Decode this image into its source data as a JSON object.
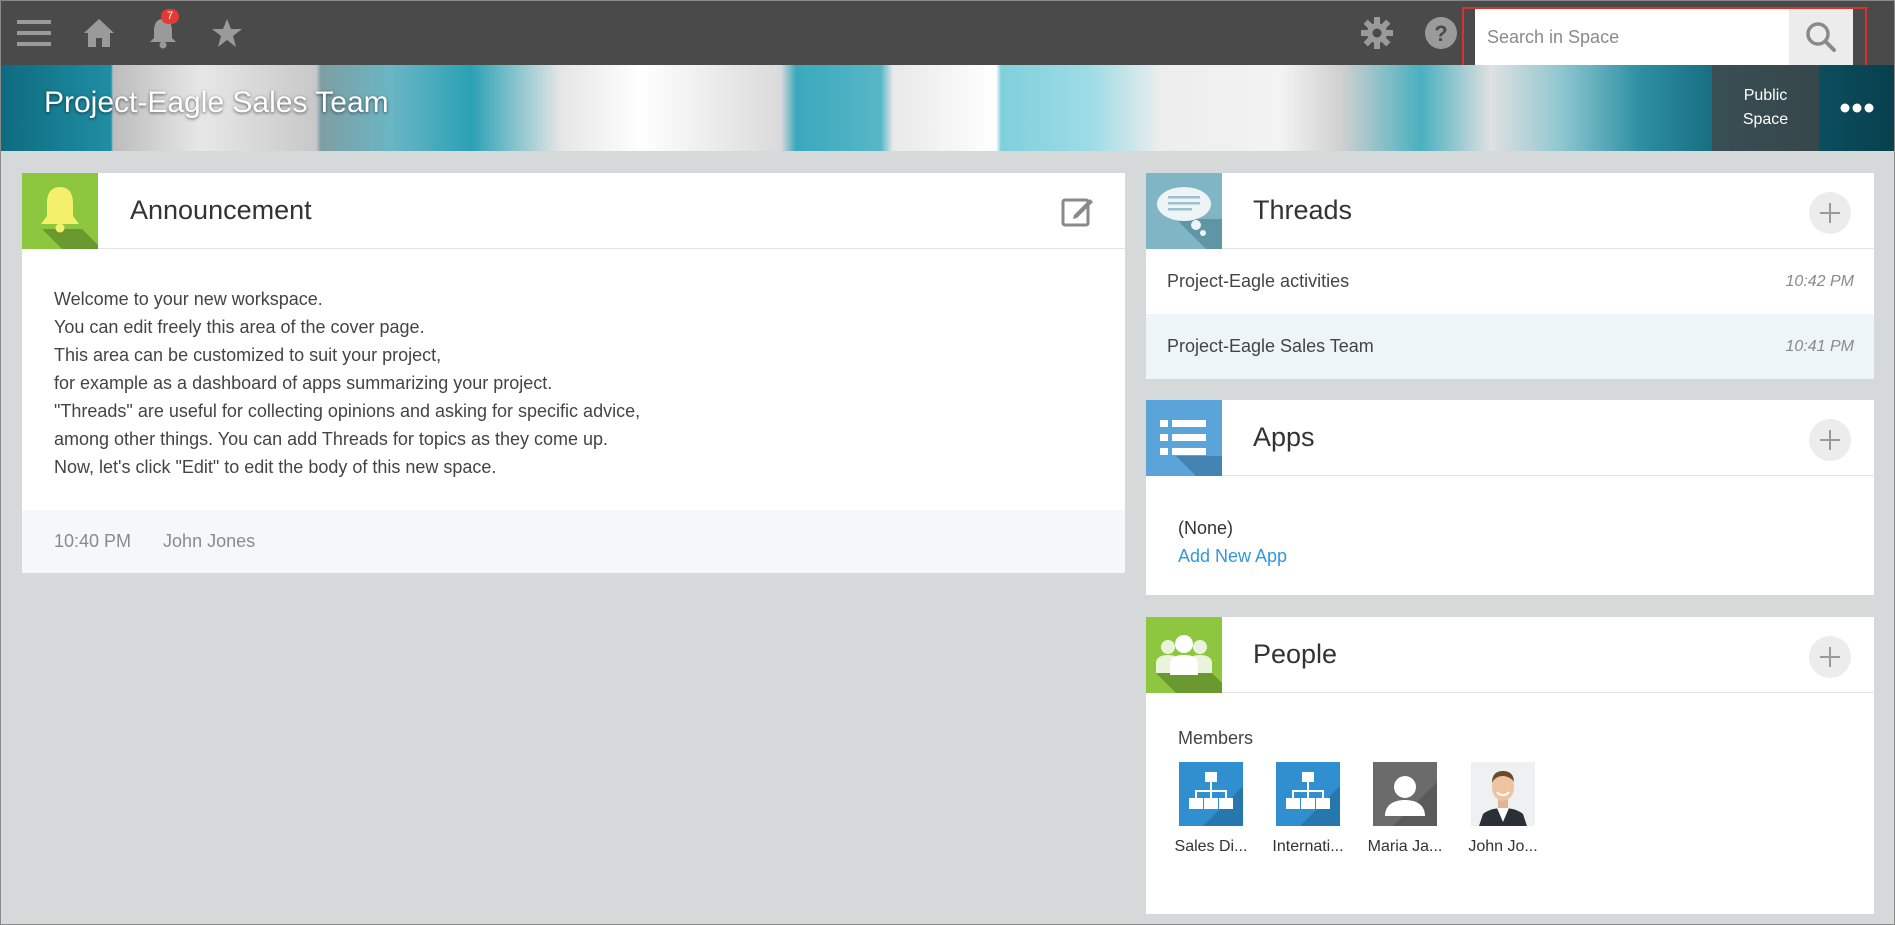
{
  "topbar": {
    "notification_count": "7",
    "search": {
      "placeholder": "Search in Space"
    }
  },
  "banner": {
    "title": "Project-Eagle Sales Team",
    "visibility_line1": "Public",
    "visibility_line2": "Space"
  },
  "announcement": {
    "title": "Announcement",
    "lines": [
      "Welcome to your new workspace.",
      "You can edit freely this area of the cover page.",
      "This area can be customized to suit your project,",
      "for example as a dashboard of apps summarizing your project.",
      "\"Threads\" are useful for collecting opinions and asking for specific advice,",
      "among other things. You can add Threads for topics as they come up.",
      "Now, let's click \"Edit\" to edit the body of this new space."
    ],
    "time": "10:40 PM",
    "author": "John Jones"
  },
  "threads": {
    "title": "Threads",
    "items": [
      {
        "name": "Project-Eagle activities",
        "time": "10:42 PM"
      },
      {
        "name": "Project-Eagle Sales Team",
        "time": "10:41 PM"
      }
    ]
  },
  "apps": {
    "title": "Apps",
    "none_label": "(None)",
    "add_label": "Add New App"
  },
  "people": {
    "title": "People",
    "members_label": "Members",
    "members": [
      {
        "name": "Sales Di...",
        "type": "org-icon"
      },
      {
        "name": "Internati...",
        "type": "org-icon"
      },
      {
        "name": "Maria Ja...",
        "type": "user-silhouette-icon"
      },
      {
        "name": "John Jo...",
        "type": "user-photo"
      }
    ]
  },
  "colors": {
    "topbar": "#4a4a4a",
    "announcement_icon_bg": "#8dc63f",
    "threads_icon_bg": "#7fb5c4",
    "apps_icon_bg": "#5ba4d9",
    "people_icon_bg": "#8dc63f",
    "link": "#3498db",
    "search_highlight": "#d9322d"
  }
}
